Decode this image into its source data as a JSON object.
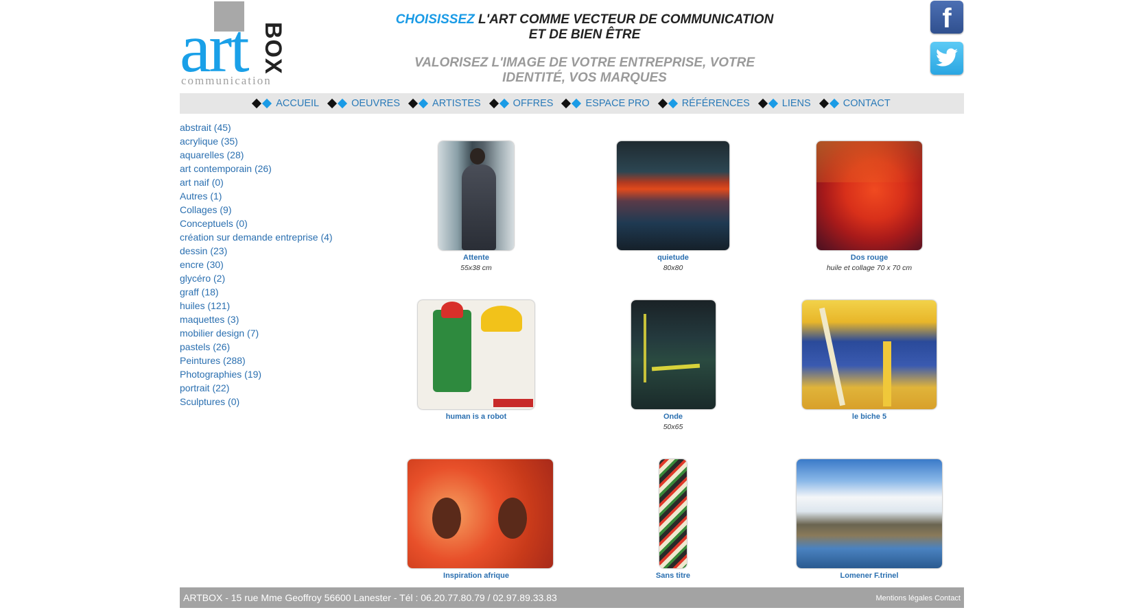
{
  "logo": {
    "art": "art",
    "box": "BOX",
    "sub": "communication"
  },
  "slogan": {
    "highlight": "CHOISISSEZ",
    "line1_rest": " L'ART COMME VECTEUR DE COMMUNICATION ET DE BIEN ÊTRE",
    "line2": "VALORISEZ L'IMAGE DE VOTRE ENTREPRISE, VOTRE IDENTITÉ, VOS MARQUES"
  },
  "social": {
    "facebook_glyph": "f",
    "facebook_icon": "facebook-icon",
    "twitter_icon": "twitter-icon"
  },
  "nav": [
    "ACCUEIL",
    "OEUVRES",
    "ARTISTES",
    "OFFRES",
    "ESPACE PRO",
    "RÉFÉRENCES",
    "LIENS",
    "CONTACT"
  ],
  "categories": [
    "abstrait (45)",
    "acrylique (35)",
    "aquarelles (28)",
    "art contemporain (26)",
    "art naif (0)",
    "Autres (1)",
    "Collages (9)",
    "Conceptuels (0)",
    "création sur demande entreprise (4)",
    "dessin (23)",
    "encre (30)",
    "glycéro (2)",
    "graff (18)",
    "huiles (121)",
    "maquettes (3)",
    "mobilier design (7)",
    "pastels (26)",
    "Peintures (288)",
    "Photographies (19)",
    "portrait (22)",
    "Sculptures (0)"
  ],
  "artworks": [
    {
      "title": "Attente",
      "size": "55x38 cm"
    },
    {
      "title": "quietude",
      "size": "80x80"
    },
    {
      "title": "Dos rouge",
      "size": "huile et collage 70 x 70 cm"
    },
    {
      "title": "human is a robot",
      "size": ""
    },
    {
      "title": "Onde",
      "size": "50x65"
    },
    {
      "title": "le biche 5",
      "size": ""
    },
    {
      "title": "Inspiration afrique",
      "size": ""
    },
    {
      "title": "Sans titre",
      "size": ""
    },
    {
      "title": "Lomener F.trinel",
      "size": ""
    }
  ],
  "footer": {
    "address": "ARTBOX - 15 rue Mme Geoffroy 56600 Lanester - Tél : 06.20.77.80.79 / 02.97.89.33.83",
    "legal": "Mentions légales",
    "contact": "Contact"
  },
  "colors": {
    "accent": "#1a9be6",
    "link": "#2a6fb0",
    "nav_bg": "#e6e6e6",
    "footer_bg": "#a3a3a3"
  }
}
